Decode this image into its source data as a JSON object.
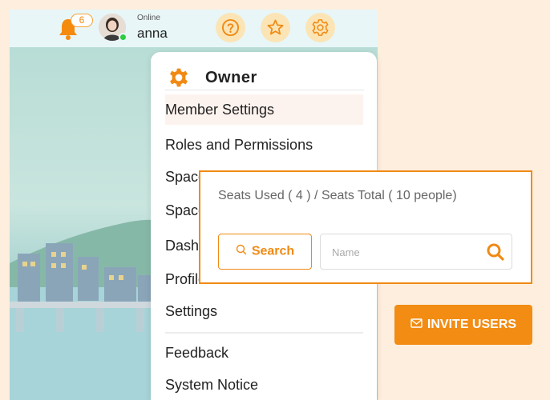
{
  "header": {
    "notification_count": "6",
    "status": "Online",
    "username": "anna"
  },
  "menu": {
    "title": "Owner",
    "items": [
      {
        "label": "Member Settings"
      },
      {
        "label": "Roles and Permissions"
      },
      {
        "label": "Space"
      },
      {
        "label": "Space"
      },
      {
        "label": "Dashb"
      },
      {
        "label": "Profile"
      },
      {
        "label": "Settings"
      },
      {
        "label": "Feedback"
      },
      {
        "label": "System Notice"
      }
    ]
  },
  "seats": {
    "summary": "Seats Used ( 4 ) / Seats Total ( 10 people)",
    "search_label": "Search",
    "name_placeholder": "Name"
  },
  "invite": {
    "label": "INVITE USERS"
  },
  "colors": {
    "accent": "#f08a14",
    "online": "#2ecc40"
  }
}
